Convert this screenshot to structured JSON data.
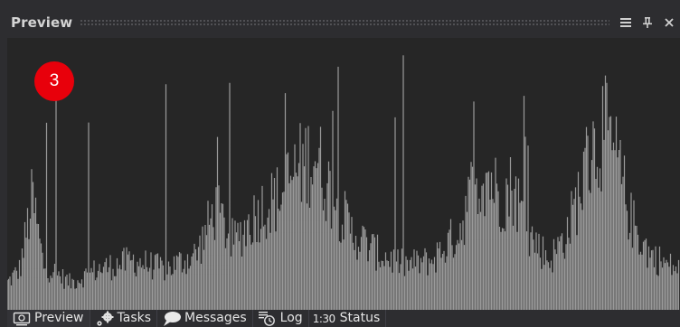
{
  "panel": {
    "title": "Preview",
    "buttons": [
      {
        "name": "menu",
        "icon": "hamburger-menu-icon",
        "glyph": "☰"
      },
      {
        "name": "pin",
        "icon": "pin-icon",
        "glyph": "ㅍ"
      },
      {
        "name": "close",
        "icon": "close-icon",
        "glyph": "✕"
      }
    ]
  },
  "badge": {
    "value": "3",
    "color": "#e8000b"
  },
  "waveform": {
    "bar_color": "#9a9a9a",
    "background": "#262626"
  },
  "tabs": [
    {
      "label": "Preview",
      "icon": "preview-icon",
      "active": true
    },
    {
      "label": "Tasks",
      "icon": "gears-icon",
      "active": false
    },
    {
      "label": "Messages",
      "icon": "speech-bubble-icon",
      "active": false
    },
    {
      "label": "Log",
      "icon": "log-clock-icon",
      "active": false
    },
    {
      "label": "Status",
      "icon": "status-icon",
      "icon_text": "1:30",
      "active": false
    }
  ]
}
